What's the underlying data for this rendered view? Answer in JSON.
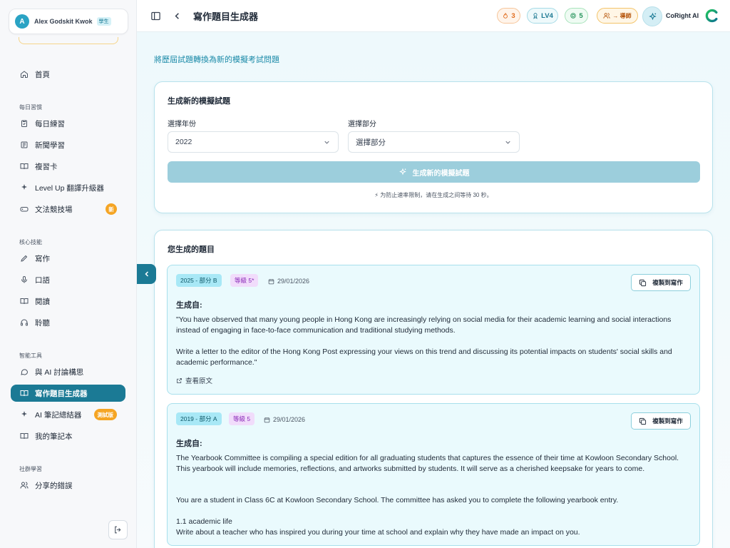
{
  "user": {
    "initial": "A",
    "name": "Alex Godskit Kwok",
    "role": "學生"
  },
  "sidebar": {
    "home": "首頁",
    "sections": [
      {
        "label": "每日習慣",
        "items": [
          "每日練習",
          "新聞學習",
          "複習卡",
          "Level Up 翻譯升級器",
          "文法競技場"
        ]
      },
      {
        "label": "核心技能",
        "items": [
          "寫作",
          "口語",
          "閱讀",
          "聆聽"
        ]
      },
      {
        "label": "智能工具",
        "items": [
          "與 AI 討論構思",
          "寫作題目生成器",
          "AI 筆記總結器",
          "我的筆記本"
        ]
      },
      {
        "label": "社群學習",
        "items": [
          "分享的錯誤"
        ]
      }
    ],
    "badges": {
      "grammar_arena": "新",
      "ai_notes": "測試版"
    },
    "active_item": "寫作題目生成器"
  },
  "header": {
    "title": "寫作題目生成器",
    "streak": "3",
    "level": "LV4",
    "coins": "5",
    "tutor_label": "→ 導師",
    "assistant_label": "CoRight AI"
  },
  "main": {
    "subtitle": "將歷屆試題轉換為新的模擬考試問題",
    "generator": {
      "title": "生成新的模擬試題",
      "year_label": "選擇年份",
      "year_value": "2022",
      "part_label": "選擇部分",
      "part_value": "選擇部分",
      "button": "生成新的模擬試題",
      "note": "⚡ 为防止速率限制，请在生成之间等待 30 秒。"
    },
    "generated": {
      "title": "您生成的題目",
      "from_label": "生成自:",
      "copy_label": "複製到寫作",
      "view_source": "查看原文",
      "questions": [
        {
          "year_part": "2025 - 部分 B",
          "level": "等級 5*",
          "date": "29/01/2026",
          "paragraphs": [
            "\"You have observed that many young people in Hong Kong are increasingly relying on social media for their academic learning and social interactions instead of engaging in face-to-face communication and traditional studying methods.",
            "Write a letter to the editor of the Hong Kong Post expressing your views on this trend and discussing its potential impacts on students' social skills and academic performance.\""
          ]
        },
        {
          "year_part": "2019 - 部分 A",
          "level": "等級 5",
          "date": "29/01/2026",
          "paragraphs": [
            "The Yearbook Committee is compiling a special edition for all graduating students that captures the essence of their time at Kowloon Secondary School. This yearbook will include memories, reflections, and artworks submitted by students. It will serve as a cherished keepsake for years to come.",
            "You are a student in Class 6C at Kowloon Secondary School. The committee has asked you to complete the following yearbook entry.",
            "1.1 academic life",
            "Write about a teacher who has inspired you during your time at school and explain why they have made an impact on you."
          ]
        }
      ]
    }
  },
  "colors": {
    "accent": "#1b7a95",
    "accent_light": "#9ccedc",
    "card_bg": "#eafafd"
  }
}
